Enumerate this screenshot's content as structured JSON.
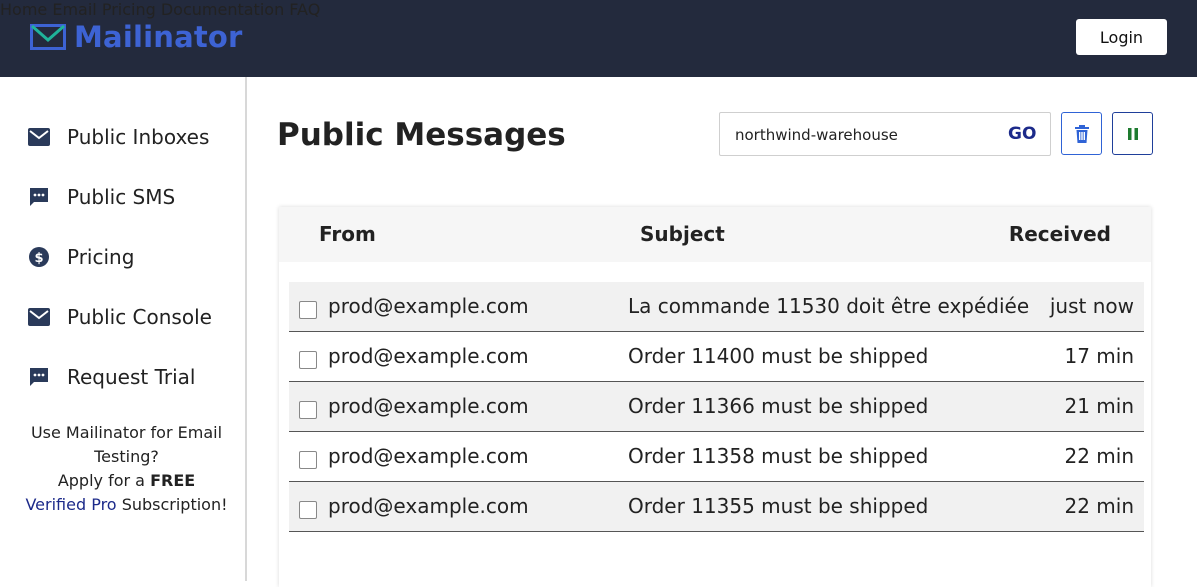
{
  "app": {
    "logo_text": "Mailinator",
    "brand_color": "#3d63d4",
    "navbar_bg": "#232a3d"
  },
  "nav": {
    "items": [
      {
        "label": "Home"
      },
      {
        "label": "Email"
      },
      {
        "label": "Pricing"
      },
      {
        "label": "Documentation"
      },
      {
        "label": "FAQ"
      }
    ],
    "login_label": "Login"
  },
  "sidebar": {
    "items": [
      {
        "label": "Public Inboxes",
        "icon": "mail-icon"
      },
      {
        "label": "Public SMS",
        "icon": "sms-icon"
      },
      {
        "label": "Pricing",
        "icon": "dollar-icon"
      },
      {
        "label": "Public Console",
        "icon": "mail-icon"
      },
      {
        "label": "Request Trial",
        "icon": "sms-icon"
      }
    ],
    "promo": {
      "line1": "Use Mailinator for Email Testing?",
      "line2_prefix": "Apply for a",
      "line2_bold": "FREE",
      "verified_pro": "Verified Pro",
      "line3_suffix": "Subscription!"
    }
  },
  "main": {
    "title": "Public Messages",
    "search": {
      "value": "northwind-warehouse",
      "go_label": "GO"
    },
    "table": {
      "headers": {
        "from": "From",
        "subject": "Subject",
        "received": "Received"
      },
      "rows": [
        {
          "from": "prod@example.com",
          "subject": "La commande 11530 doit être expédiée",
          "received": "just now"
        },
        {
          "from": "prod@example.com",
          "subject": "Order 11400 must be shipped",
          "received": "17 min"
        },
        {
          "from": "prod@example.com",
          "subject": "Order 11366 must be shipped",
          "received": "21 min"
        },
        {
          "from": "prod@example.com",
          "subject": "Order 11358 must be shipped",
          "received": "22 min"
        },
        {
          "from": "prod@example.com",
          "subject": "Order 11355 must be shipped",
          "received": "22 min"
        }
      ]
    }
  }
}
